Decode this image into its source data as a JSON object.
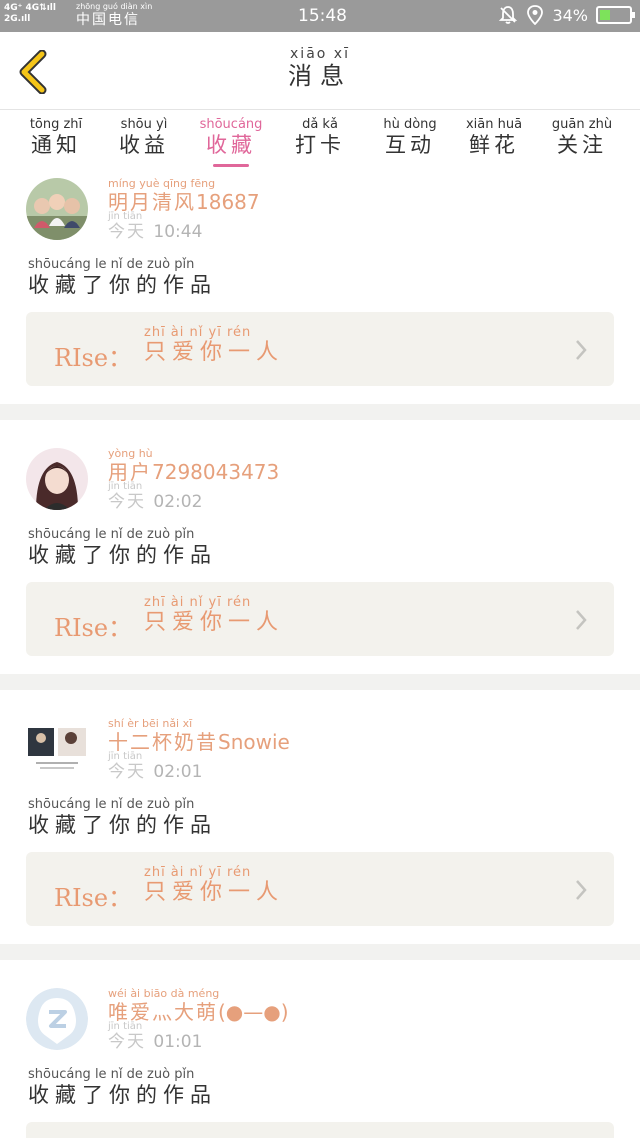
{
  "status_bar": {
    "network_line1": "4G⁺ 4G⇅ıll",
    "network_line2": "2G.ıll",
    "carrier_pinyin": "zhōng guó diàn xìn",
    "carrier": "中国电信",
    "time": "15:48",
    "battery": "34%",
    "battery_level": 0.34
  },
  "header": {
    "back_icon": "chevron-left-icon",
    "title_pinyin": "xiāo xī",
    "title": "消息"
  },
  "tabs": [
    {
      "pinyin": "tōng zhī",
      "label": "通知",
      "active": false
    },
    {
      "pinyin": "shōu yì",
      "label": "收益",
      "active": false
    },
    {
      "pinyin": "shōucáng",
      "label": "收藏",
      "active": true
    },
    {
      "pinyin": "dǎ kǎ",
      "label": "打卡",
      "active": false
    },
    {
      "pinyin": "hù dòng",
      "label": "互动",
      "active": false
    },
    {
      "pinyin": "xiān huā",
      "label": "鲜花",
      "active": false
    },
    {
      "pinyin": "guān zhù",
      "label": "关注",
      "active": false
    }
  ],
  "items": [
    {
      "user_pinyin": "míng yuè qīng fēng",
      "user_hz": "明月清风",
      "user_num": "18687",
      "time_pinyin": "jīn tiān",
      "time_hz": "今天",
      "time": "10:44",
      "action_pinyin": "shōucáng le nǐ de zuò pǐn",
      "action": "收藏了你的作品",
      "work_label": "RIse：",
      "work_pinyin": "zhī ài nǐ yī rén",
      "work_title": "只爱你一人"
    },
    {
      "user_pinyin": "yòng hù",
      "user_hz": "用户",
      "user_num": "7298043473",
      "time_pinyin": "jīn tiān",
      "time_hz": "今天",
      "time": "02:02",
      "action_pinyin": "shōucáng le nǐ de zuò pǐn",
      "action": "收藏了你的作品",
      "work_label": "RIse：",
      "work_pinyin": "zhī ài nǐ yī rén",
      "work_title": "只爱你一人"
    },
    {
      "user_pinyin": "shí èr bēi nǎi xī",
      "user_hz": "十二杯奶昔",
      "user_num": "Snowie",
      "time_pinyin": "jīn tiān",
      "time_hz": "今天",
      "time": "02:01",
      "action_pinyin": "shōucáng le nǐ de zuò pǐn",
      "action": "收藏了你的作品",
      "work_label": "RIse：",
      "work_pinyin": "zhī ài nǐ yī rén",
      "work_title": "只爱你一人"
    },
    {
      "user_pinyin": "wéi ài biāo dà méng",
      "user_hz": "唯爱灬大萌",
      "user_num": "(●—●)",
      "time_pinyin": "jīn tiān",
      "time_hz": "今天",
      "time": "01:01",
      "action_pinyin": "shōucáng le nǐ de zuò pǐn",
      "action": "收藏了你的作品"
    }
  ]
}
